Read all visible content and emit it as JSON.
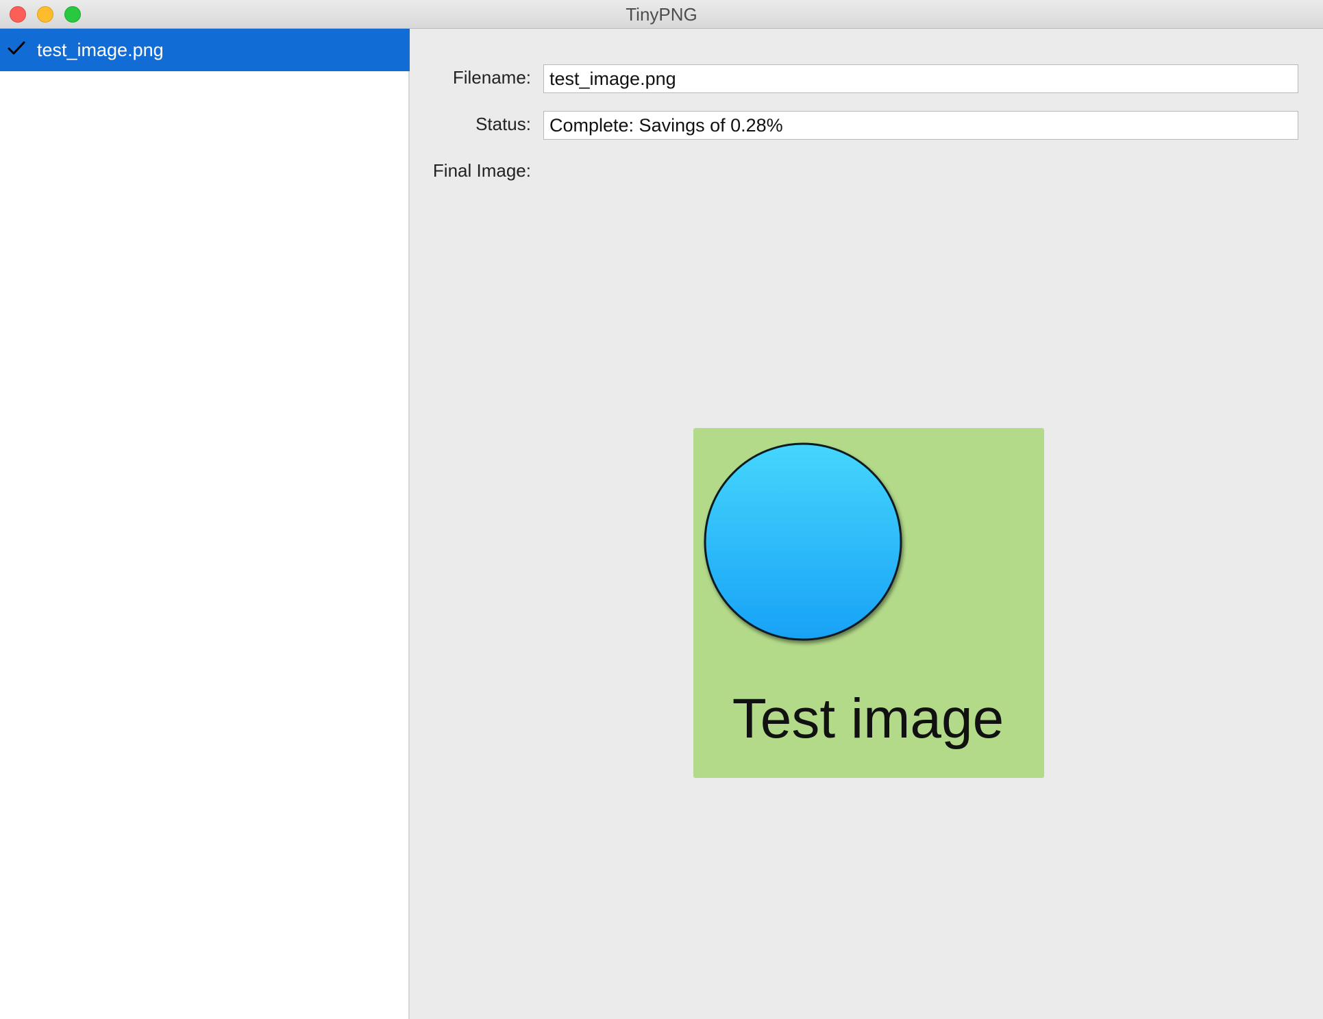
{
  "window": {
    "title": "TinyPNG"
  },
  "sidebar": {
    "items": [
      {
        "label": "test_image.png",
        "status_icon": "checkmark-icon",
        "selected": true
      }
    ]
  },
  "detail": {
    "filename_label": "Filename:",
    "filename_value": "test_image.png",
    "status_label": "Status:",
    "status_value": "Complete: Savings of 0.28%",
    "final_image_label": "Final Image:"
  },
  "preview_image": {
    "caption": "Test image",
    "background_color": "#b3da89",
    "circle_color_top": "#45d6fc",
    "circle_color_bottom": "#18a2f7"
  },
  "colors": {
    "selection": "#116cd6",
    "window_background": "#ebebeb"
  }
}
